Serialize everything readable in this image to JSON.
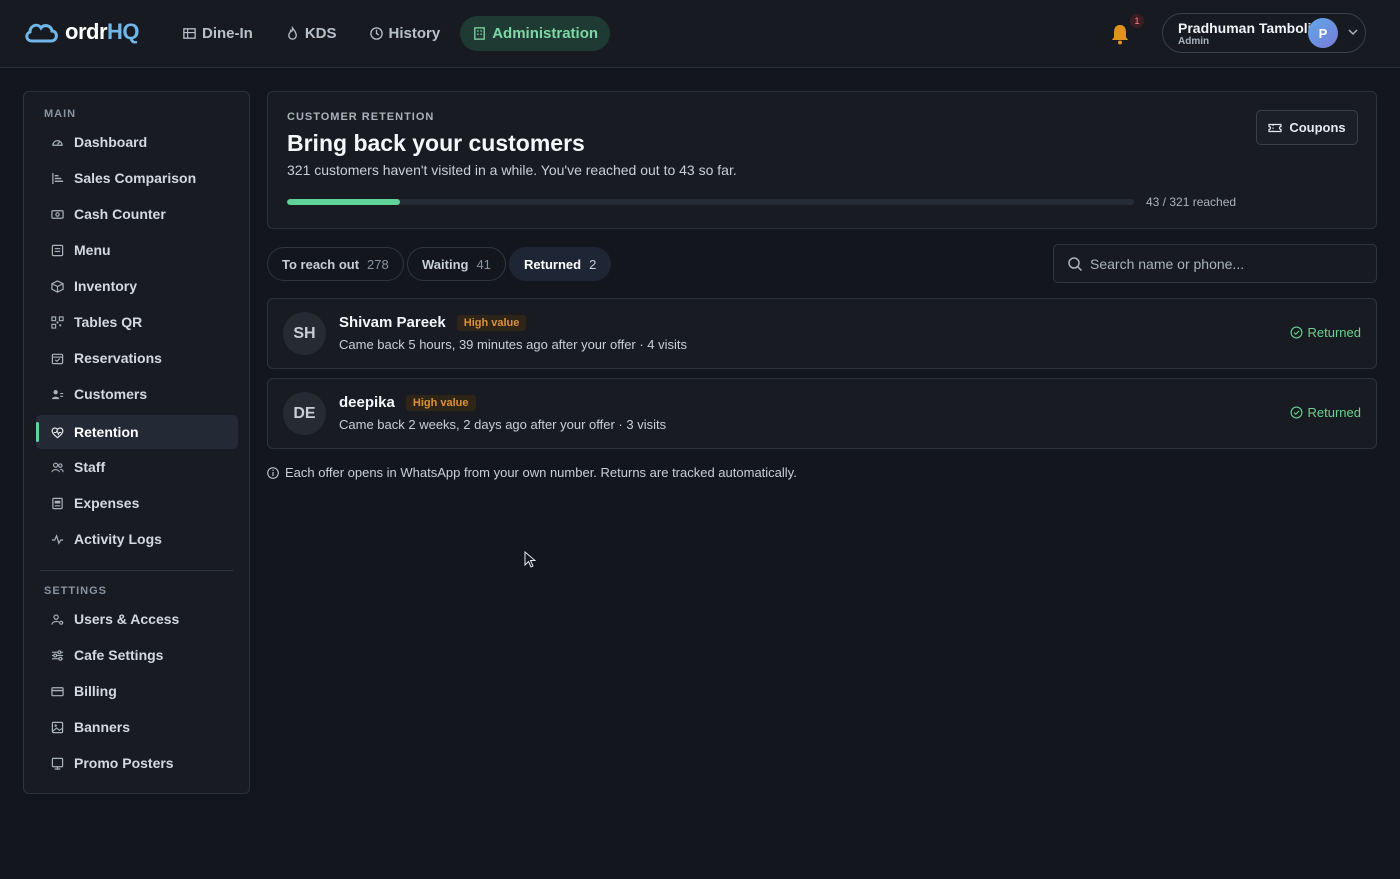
{
  "app": {
    "logo_text_main": "ordr",
    "logo_text_accent": "HQ",
    "nav": [
      {
        "label": "Dine-In",
        "icon": "table-icon"
      },
      {
        "label": "KDS",
        "icon": "flame-icon"
      },
      {
        "label": "History",
        "icon": "clock-icon"
      },
      {
        "label": "Administration",
        "icon": "building-icon",
        "active": true
      }
    ],
    "notifications_count": "1",
    "user": {
      "name": "Pradhuman Tamboli",
      "role": "Admin",
      "initial": "P"
    }
  },
  "sidebar": {
    "main_heading": "MAIN",
    "main_items": [
      {
        "label": "Dashboard",
        "icon": "gauge-icon"
      },
      {
        "label": "Sales Comparison",
        "icon": "bars-icon"
      },
      {
        "label": "Cash Counter",
        "icon": "cash-icon"
      },
      {
        "label": "Menu",
        "icon": "menu-icon"
      },
      {
        "label": "Inventory",
        "icon": "box-icon"
      },
      {
        "label": "Tables QR",
        "icon": "qr-icon"
      },
      {
        "label": "Reservations",
        "icon": "calendar-icon"
      },
      {
        "label": "Customers",
        "icon": "users-icon"
      },
      {
        "label": "Retention",
        "icon": "heart-pulse-icon",
        "active": true
      },
      {
        "label": "Staff",
        "icon": "staff-icon"
      },
      {
        "label": "Expenses",
        "icon": "receipt-icon"
      },
      {
        "label": "Activity Logs",
        "icon": "activity-icon"
      }
    ],
    "settings_heading": "SETTINGS",
    "settings_items": [
      {
        "label": "Users & Access",
        "icon": "user-key-icon"
      },
      {
        "label": "Cafe Settings",
        "icon": "sliders-icon"
      },
      {
        "label": "Billing",
        "icon": "card-icon"
      },
      {
        "label": "Banners",
        "icon": "image-icon"
      },
      {
        "label": "Promo Posters",
        "icon": "poster-icon"
      }
    ]
  },
  "hero": {
    "eyebrow": "CUSTOMER RETENTION",
    "title": "Bring back your customers",
    "subtitle": "321 customers haven't visited in a while. You've reached out to 43 so far.",
    "progress_reached": 43,
    "progress_total": 321,
    "progress_label": "43 / 321 reached",
    "coupons_label": "Coupons"
  },
  "tabs": [
    {
      "label": "To reach out",
      "count": "278"
    },
    {
      "label": "Waiting",
      "count": "41"
    },
    {
      "label": "Returned",
      "count": "2",
      "active": true
    }
  ],
  "search": {
    "placeholder": "Search name or phone..."
  },
  "customers": [
    {
      "initials": "SH",
      "name": "Shivam Pareek",
      "badge": "High value",
      "detail": "Came back 5 hours, 39 minutes ago after your offer · 4 visits",
      "status": "Returned"
    },
    {
      "initials": "DE",
      "name": "deepika",
      "badge": "High value",
      "detail": "Came back 2 weeks, 2 days ago after your offer · 3 visits",
      "status": "Returned"
    }
  ],
  "footnote": "Each offer opens in WhatsApp from your own number. Returns are tracked automatically.",
  "colors": {
    "accent": "#5fd39a",
    "badge": "#d9913a",
    "returned": "#6fcf8d"
  }
}
